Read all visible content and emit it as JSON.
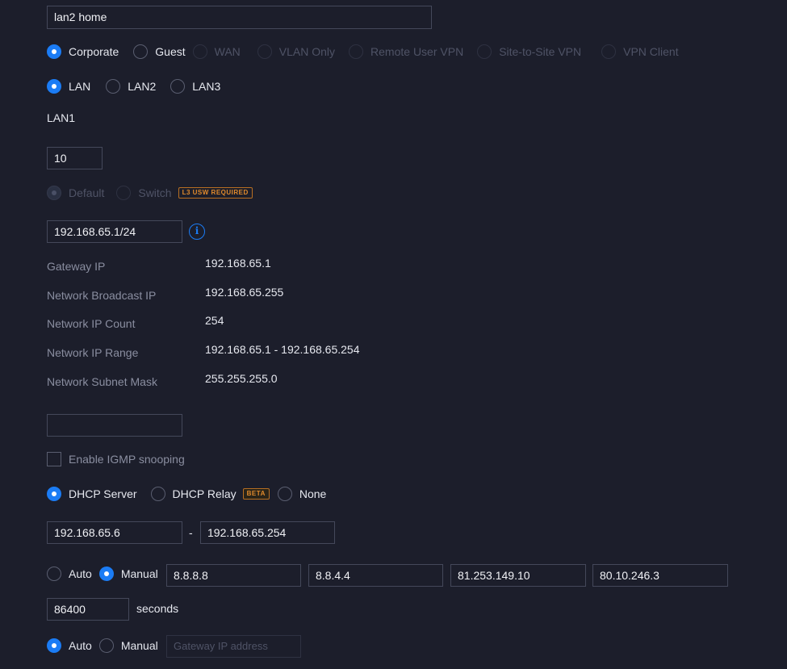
{
  "network_name": {
    "value": "lan2 home"
  },
  "purpose": {
    "options": [
      {
        "label": "Corporate",
        "state": "selected"
      },
      {
        "label": "Guest",
        "state": "normal"
      },
      {
        "label": "WAN",
        "state": "disabled"
      },
      {
        "label": "VLAN Only",
        "state": "disabled"
      },
      {
        "label": "Remote User VPN",
        "state": "disabled"
      },
      {
        "label": "Site-to-Site VPN",
        "state": "disabled"
      },
      {
        "label": "VPN Client",
        "state": "disabled"
      }
    ]
  },
  "interface": {
    "options": [
      {
        "label": "LAN",
        "state": "selected"
      },
      {
        "label": "LAN2",
        "state": "normal"
      },
      {
        "label": "LAN3",
        "state": "normal"
      }
    ],
    "port_label": "LAN1"
  },
  "vlan": {
    "value": "10"
  },
  "routing": {
    "default_label": "Default",
    "switch_label": "Switch",
    "badge": "L3 USW REQUIRED"
  },
  "subnet": {
    "value": "192.168.65.1/24",
    "info_icon": "i"
  },
  "network_info": {
    "gateway_ip_label": "Gateway IP",
    "gateway_ip": "192.168.65.1",
    "broadcast_label": "Network Broadcast IP",
    "broadcast": "192.168.65.255",
    "count_label": "Network IP Count",
    "count": "254",
    "range_label": "Network IP Range",
    "range": "192.168.65.1 - 192.168.65.254",
    "mask_label": "Network Subnet Mask",
    "mask": "255.255.255.0"
  },
  "domain_name": {
    "value": ""
  },
  "igmp": {
    "label": "Enable IGMP snooping",
    "checked": false
  },
  "dhcp_mode": {
    "server_label": "DHCP Server",
    "relay_label": "DHCP Relay",
    "relay_badge": "BETA",
    "none_label": "None"
  },
  "dhcp_range": {
    "start": "192.168.65.6",
    "separator": "-",
    "stop": "192.168.65.254"
  },
  "dns": {
    "auto_label": "Auto",
    "manual_label": "Manual",
    "servers": [
      "8.8.8.8",
      "8.8.4.4",
      "81.253.149.10",
      "80.10.246.3"
    ]
  },
  "lease": {
    "value": "86400",
    "unit": "seconds"
  },
  "gateway": {
    "auto_label": "Auto",
    "manual_label": "Manual",
    "placeholder": "Gateway IP address"
  },
  "colors": {
    "background": "#1c1e2b",
    "accent": "#1b7cf5",
    "badge": "#e08a2c"
  }
}
